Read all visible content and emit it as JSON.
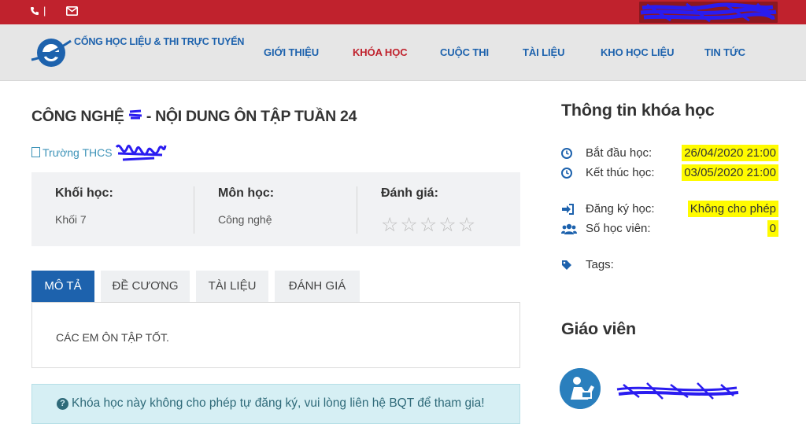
{
  "topbar": {
    "phone_icon": "phone-icon",
    "separator": "|",
    "mail_icon": "mail-icon",
    "account_redacted": true
  },
  "header": {
    "brand": "CỔNG HỌC LIỆU & THI TRỰC TUYẾN",
    "nav": [
      {
        "label": "GIỚI THIỆU",
        "active": false
      },
      {
        "label": "KHÓA HỌC",
        "active": true
      },
      {
        "label": "CUỘC THI",
        "active": false
      },
      {
        "label": "TÀI LIỆU",
        "active": false
      },
      {
        "label": "KHO HỌC LIỆU",
        "active": false
      },
      {
        "label": "TIN TỨC",
        "active": false
      }
    ]
  },
  "course": {
    "title_prefix": "CÔNG NGHỆ",
    "title_suffix": "- NỘI DUNG ÔN TẬP TUẦN 24",
    "school": "Trường THCS",
    "grade_label": "Khối học:",
    "grade_value": "Khối 7",
    "subject_label": "Môn học:",
    "subject_value": "Công nghệ",
    "rating_label": "Đánh giá:",
    "rating_stars": 0,
    "rating_max": 5
  },
  "tabs": [
    {
      "label": "MÔ TẢ",
      "active": true
    },
    {
      "label": "ĐỀ CƯƠNG",
      "active": false
    },
    {
      "label": "TÀI LIỆU",
      "active": false
    },
    {
      "label": "ĐÁNH GIÁ",
      "active": false
    }
  ],
  "description": "CÁC EM ÔN TẬP TỐT.",
  "alert": "Khóa học này không cho phép tự đăng ký, vui lòng liên hệ BQT để tham gia!",
  "sidebar": {
    "info_title": "Thông tin khóa học",
    "start_label": "Bắt đầu học:",
    "start_value": "26/04/2020 21:00",
    "end_label": "Kết thúc học:",
    "end_value": "03/05/2020 21:00",
    "register_label": "Đăng ký học:",
    "register_value": "Không cho phép",
    "students_label": "Số học viên:",
    "students_value": "0",
    "tags_label": "Tags:",
    "teacher_title": "Giáo viên",
    "highlight_color": "#fffb00"
  },
  "colors": {
    "topbar": "#c0222d",
    "brand_blue": "#1d62ad",
    "nav_active": "#c0222d",
    "alert_bg": "#d6eff4"
  }
}
